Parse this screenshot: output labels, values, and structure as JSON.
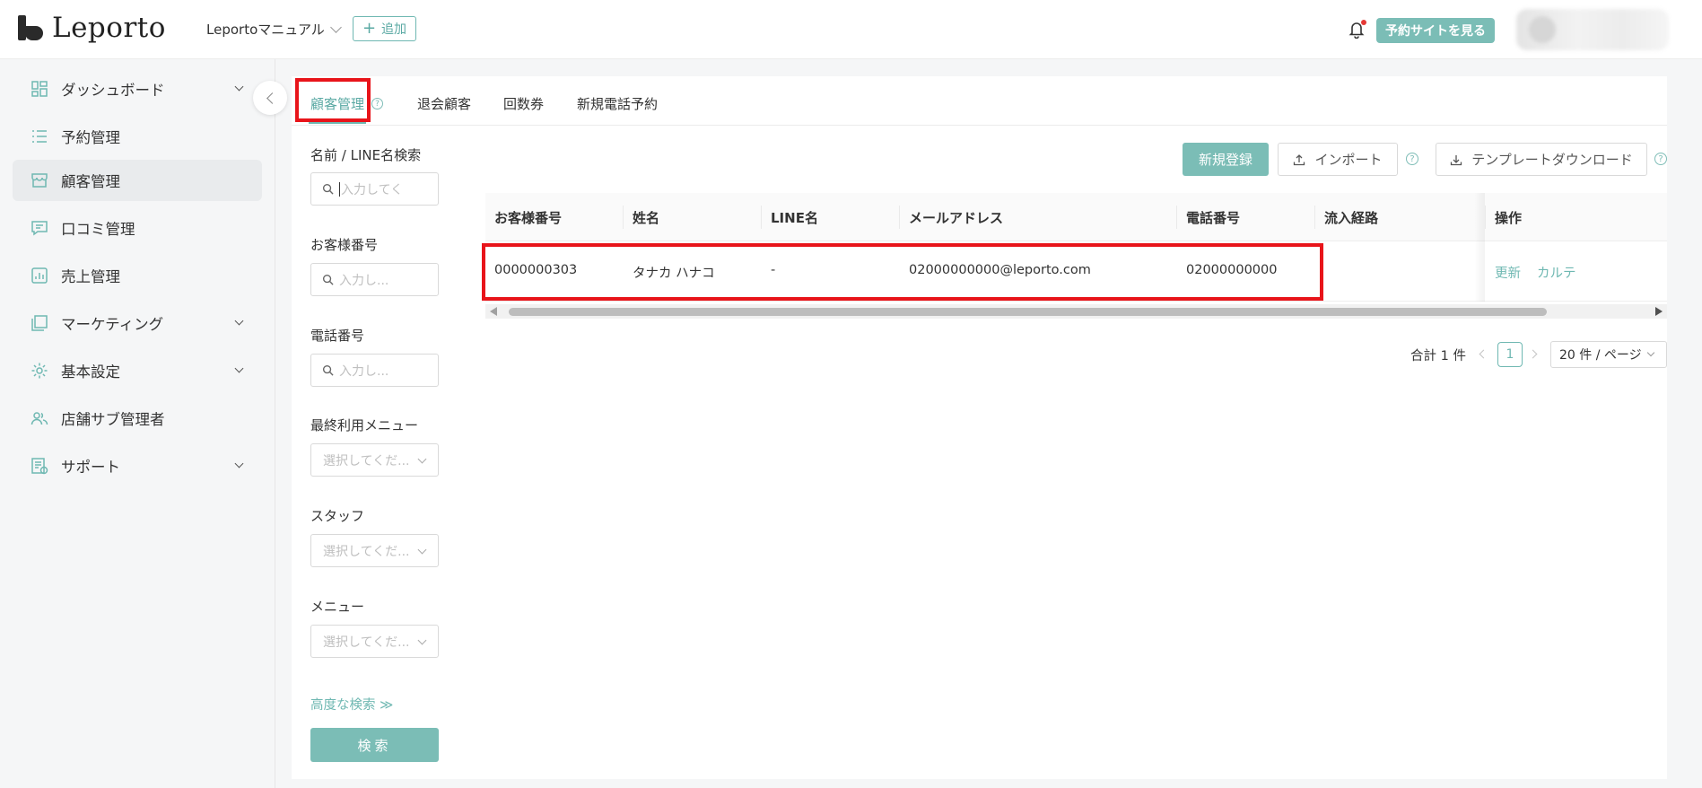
{
  "header": {
    "logo_text": "Leporto",
    "store_name": "Leportoマニュアル",
    "add_label": "追加",
    "site_button": "予約サイトを見る"
  },
  "sidebar": {
    "items": [
      {
        "label": "ダッシュボード",
        "icon": "dashboard-icon",
        "expandable": true
      },
      {
        "label": "予約管理",
        "icon": "list-icon",
        "expandable": false
      },
      {
        "label": "顧客管理",
        "icon": "store-icon",
        "expandable": false,
        "active": true
      },
      {
        "label": "口コミ管理",
        "icon": "comment-icon",
        "expandable": false
      },
      {
        "label": "売上管理",
        "icon": "chart-icon",
        "expandable": false
      },
      {
        "label": "マーケティング",
        "icon": "cards-icon",
        "expandable": true
      },
      {
        "label": "基本設定",
        "icon": "gear-icon",
        "expandable": true
      },
      {
        "label": "店舗サブ管理者",
        "icon": "users-icon",
        "expandable": false
      },
      {
        "label": "サポート",
        "icon": "support-icon",
        "expandable": true
      }
    ]
  },
  "tabs": [
    {
      "label": "顧客管理",
      "active": true
    },
    {
      "label": "退会顧客"
    },
    {
      "label": "回数券"
    },
    {
      "label": "新規電話予約"
    }
  ],
  "filters": {
    "name_label": "名前 / LINE名検索",
    "name_placeholder": "入力してく",
    "customer_no_label": "お客様番号",
    "customer_no_placeholder": "入力し...",
    "phone_label": "電話番号",
    "phone_placeholder": "入力し...",
    "last_menu_label": "最終利用メニュー",
    "last_menu_placeholder": "選択してくだ...",
    "staff_label": "スタッフ",
    "staff_placeholder": "選択してくだ...",
    "menu_label": "メニュー",
    "menu_placeholder": "選択してくだ...",
    "advanced": "高度な検索 ≫",
    "search_button": "検索"
  },
  "actions": {
    "new": "新規登録",
    "import": "インポート",
    "template": "テンプレートダウンロード"
  },
  "table": {
    "columns": [
      "お客様番号",
      "姓名",
      "LINE名",
      "メールアドレス",
      "電話番号",
      "流入経路",
      "操作"
    ],
    "rows": [
      {
        "customer_no": "0000000303",
        "name": "タナカ ハナコ",
        "line_name": "-",
        "email": "02000000000@leporto.com",
        "phone": "02000000000",
        "source": "",
        "op_update": "更新",
        "op_karte": "カルテ"
      }
    ]
  },
  "pagination": {
    "total": "合計 1 件",
    "current": "1",
    "page_size": "20 件 / ページ"
  },
  "colors": {
    "accent": "#7bbdb6",
    "highlight": "#e8141a"
  }
}
